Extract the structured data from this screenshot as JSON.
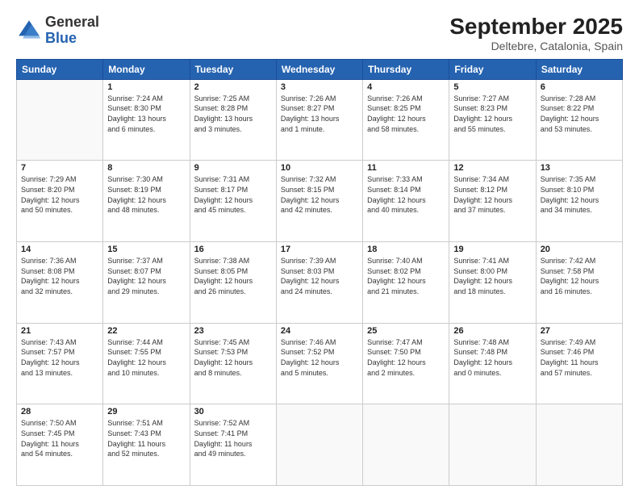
{
  "logo": {
    "general": "General",
    "blue": "Blue"
  },
  "title": "September 2025",
  "subtitle": "Deltebre, Catalonia, Spain",
  "days_of_week": [
    "Sunday",
    "Monday",
    "Tuesday",
    "Wednesday",
    "Thursday",
    "Friday",
    "Saturday"
  ],
  "weeks": [
    [
      {
        "day": "",
        "info": ""
      },
      {
        "day": "1",
        "info": "Sunrise: 7:24 AM\nSunset: 8:30 PM\nDaylight: 13 hours\nand 6 minutes."
      },
      {
        "day": "2",
        "info": "Sunrise: 7:25 AM\nSunset: 8:28 PM\nDaylight: 13 hours\nand 3 minutes."
      },
      {
        "day": "3",
        "info": "Sunrise: 7:26 AM\nSunset: 8:27 PM\nDaylight: 13 hours\nand 1 minute."
      },
      {
        "day": "4",
        "info": "Sunrise: 7:26 AM\nSunset: 8:25 PM\nDaylight: 12 hours\nand 58 minutes."
      },
      {
        "day": "5",
        "info": "Sunrise: 7:27 AM\nSunset: 8:23 PM\nDaylight: 12 hours\nand 55 minutes."
      },
      {
        "day": "6",
        "info": "Sunrise: 7:28 AM\nSunset: 8:22 PM\nDaylight: 12 hours\nand 53 minutes."
      }
    ],
    [
      {
        "day": "7",
        "info": "Sunrise: 7:29 AM\nSunset: 8:20 PM\nDaylight: 12 hours\nand 50 minutes."
      },
      {
        "day": "8",
        "info": "Sunrise: 7:30 AM\nSunset: 8:19 PM\nDaylight: 12 hours\nand 48 minutes."
      },
      {
        "day": "9",
        "info": "Sunrise: 7:31 AM\nSunset: 8:17 PM\nDaylight: 12 hours\nand 45 minutes."
      },
      {
        "day": "10",
        "info": "Sunrise: 7:32 AM\nSunset: 8:15 PM\nDaylight: 12 hours\nand 42 minutes."
      },
      {
        "day": "11",
        "info": "Sunrise: 7:33 AM\nSunset: 8:14 PM\nDaylight: 12 hours\nand 40 minutes."
      },
      {
        "day": "12",
        "info": "Sunrise: 7:34 AM\nSunset: 8:12 PM\nDaylight: 12 hours\nand 37 minutes."
      },
      {
        "day": "13",
        "info": "Sunrise: 7:35 AM\nSunset: 8:10 PM\nDaylight: 12 hours\nand 34 minutes."
      }
    ],
    [
      {
        "day": "14",
        "info": "Sunrise: 7:36 AM\nSunset: 8:08 PM\nDaylight: 12 hours\nand 32 minutes."
      },
      {
        "day": "15",
        "info": "Sunrise: 7:37 AM\nSunset: 8:07 PM\nDaylight: 12 hours\nand 29 minutes."
      },
      {
        "day": "16",
        "info": "Sunrise: 7:38 AM\nSunset: 8:05 PM\nDaylight: 12 hours\nand 26 minutes."
      },
      {
        "day": "17",
        "info": "Sunrise: 7:39 AM\nSunset: 8:03 PM\nDaylight: 12 hours\nand 24 minutes."
      },
      {
        "day": "18",
        "info": "Sunrise: 7:40 AM\nSunset: 8:02 PM\nDaylight: 12 hours\nand 21 minutes."
      },
      {
        "day": "19",
        "info": "Sunrise: 7:41 AM\nSunset: 8:00 PM\nDaylight: 12 hours\nand 18 minutes."
      },
      {
        "day": "20",
        "info": "Sunrise: 7:42 AM\nSunset: 7:58 PM\nDaylight: 12 hours\nand 16 minutes."
      }
    ],
    [
      {
        "day": "21",
        "info": "Sunrise: 7:43 AM\nSunset: 7:57 PM\nDaylight: 12 hours\nand 13 minutes."
      },
      {
        "day": "22",
        "info": "Sunrise: 7:44 AM\nSunset: 7:55 PM\nDaylight: 12 hours\nand 10 minutes."
      },
      {
        "day": "23",
        "info": "Sunrise: 7:45 AM\nSunset: 7:53 PM\nDaylight: 12 hours\nand 8 minutes."
      },
      {
        "day": "24",
        "info": "Sunrise: 7:46 AM\nSunset: 7:52 PM\nDaylight: 12 hours\nand 5 minutes."
      },
      {
        "day": "25",
        "info": "Sunrise: 7:47 AM\nSunset: 7:50 PM\nDaylight: 12 hours\nand 2 minutes."
      },
      {
        "day": "26",
        "info": "Sunrise: 7:48 AM\nSunset: 7:48 PM\nDaylight: 12 hours\nand 0 minutes."
      },
      {
        "day": "27",
        "info": "Sunrise: 7:49 AM\nSunset: 7:46 PM\nDaylight: 11 hours\nand 57 minutes."
      }
    ],
    [
      {
        "day": "28",
        "info": "Sunrise: 7:50 AM\nSunset: 7:45 PM\nDaylight: 11 hours\nand 54 minutes."
      },
      {
        "day": "29",
        "info": "Sunrise: 7:51 AM\nSunset: 7:43 PM\nDaylight: 11 hours\nand 52 minutes."
      },
      {
        "day": "30",
        "info": "Sunrise: 7:52 AM\nSunset: 7:41 PM\nDaylight: 11 hours\nand 49 minutes."
      },
      {
        "day": "",
        "info": ""
      },
      {
        "day": "",
        "info": ""
      },
      {
        "day": "",
        "info": ""
      },
      {
        "day": "",
        "info": ""
      }
    ]
  ]
}
